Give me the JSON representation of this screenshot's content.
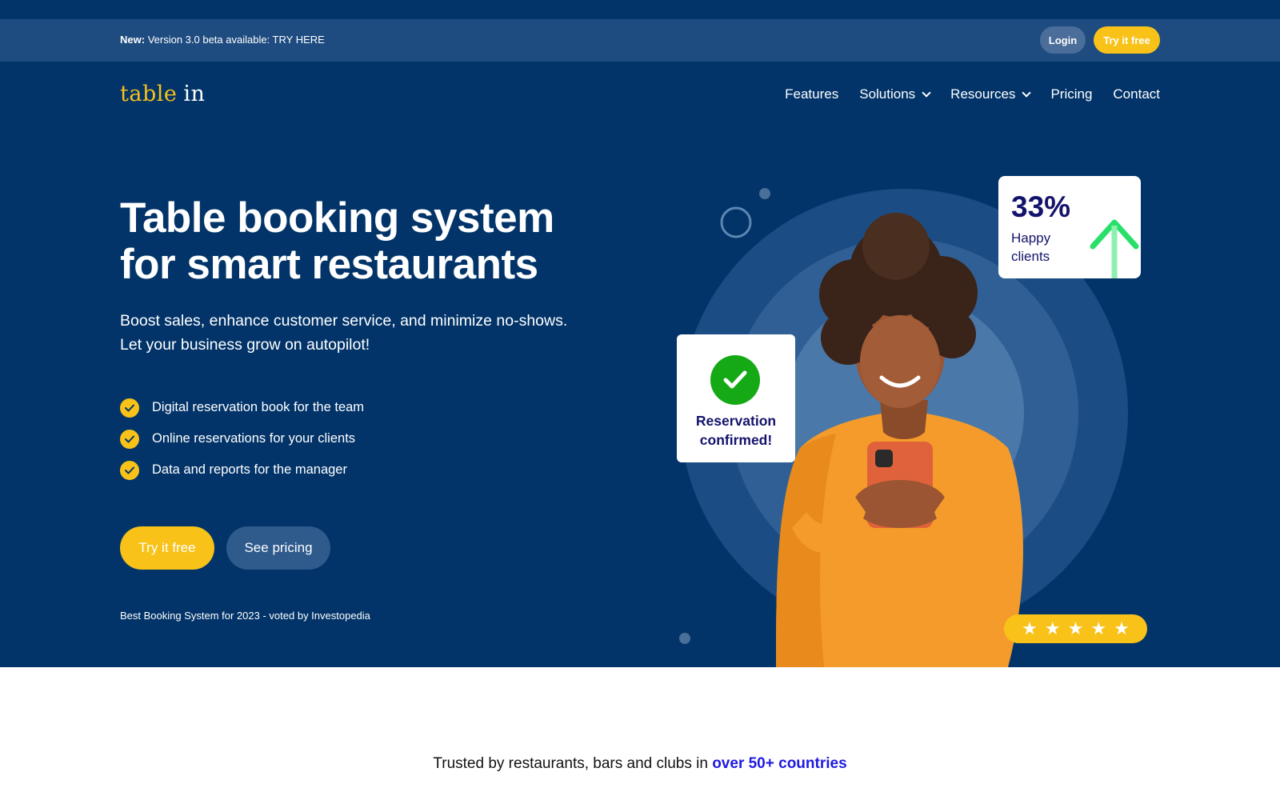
{
  "announcement": {
    "prefix": "New:",
    "text": "Version 3.0 beta available: TRY HERE",
    "login_label": "Login",
    "try_label": "Try it free"
  },
  "logo": {
    "part1": "table",
    "part2": "in"
  },
  "nav": {
    "items": [
      {
        "label": "Features",
        "dropdown": false
      },
      {
        "label": "Solutions",
        "dropdown": true
      },
      {
        "label": "Resources",
        "dropdown": true
      },
      {
        "label": "Pricing",
        "dropdown": false
      },
      {
        "label": "Contact",
        "dropdown": false
      }
    ]
  },
  "hero": {
    "title_line1": "Table booking system",
    "title_line2": "for smart restaurants",
    "subtitle_line1": "Boost sales, enhance customer service, and minimize no-shows.",
    "subtitle_line2": "Let your business grow on autopilot!",
    "features": [
      "Digital reservation book for the team",
      "Online reservations for your clients",
      "Data and reports for the manager"
    ],
    "cta_primary": "Try it free",
    "cta_secondary": "See pricing",
    "award": "Best Booking System for 2023 - voted by Investopedia"
  },
  "stat_card": {
    "value": "33%",
    "label_line1": "Happy",
    "label_line2": "clients"
  },
  "reservation_card": {
    "line1": "Reservation",
    "line2": "confirmed!"
  },
  "rating": {
    "stars": 5
  },
  "trusted": {
    "text": "Trusted by restaurants, bars and clubs in",
    "highlight": "over 50+ countries"
  },
  "colors": {
    "primary_navy": "#023469",
    "announce_bar": "#1e4c80",
    "accent_yellow": "#f8c219",
    "secondary_button": "#2e5a8c",
    "success_green": "#16a916",
    "highlight_blue": "#1f1ae0"
  }
}
